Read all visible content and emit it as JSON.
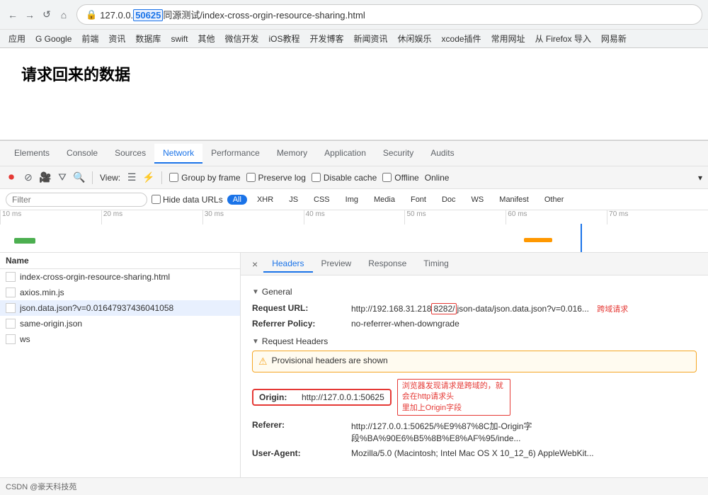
{
  "browser": {
    "nav": {
      "back_label": "←",
      "forward_label": "→",
      "reload_label": "↺",
      "url_prefix": "127.0.0.",
      "url_highlight": "50625",
      "url_suffix": "同源测试/index-cross-orgin-resource-sharing.html"
    },
    "bookmarks": [
      "应用",
      "G Google",
      "前端",
      "资讯",
      "数据库",
      "swift",
      "其他",
      "微信开发",
      "iOS教程",
      "开发博客",
      "新闻资讯",
      "休闲娱乐",
      "xcode插件",
      "常用网址",
      "从 Firefox 导入",
      "网易新"
    ]
  },
  "page": {
    "title": "请求回来的数据"
  },
  "devtools": {
    "tabs": [
      {
        "label": "Elements",
        "active": false
      },
      {
        "label": "Console",
        "active": false
      },
      {
        "label": "Sources",
        "active": false
      },
      {
        "label": "Network",
        "active": true
      },
      {
        "label": "Performance",
        "active": false
      },
      {
        "label": "Memory",
        "active": false
      },
      {
        "label": "Application",
        "active": false
      },
      {
        "label": "Security",
        "active": false
      },
      {
        "label": "Audits",
        "active": false
      }
    ],
    "toolbar": {
      "view_label": "View:",
      "group_by_frame_label": "Group by frame",
      "preserve_log_label": "Preserve log",
      "disable_cache_label": "Disable cache",
      "offline_label": "Offline",
      "online_label": "Online"
    },
    "filter": {
      "placeholder": "Filter",
      "hide_data_urls_label": "Hide data URLs",
      "types": [
        "All",
        "XHR",
        "JS",
        "CSS",
        "Img",
        "Media",
        "Font",
        "Doc",
        "WS",
        "Manifest",
        "Other"
      ]
    },
    "timeline": {
      "ticks": [
        "10 ms",
        "20 ms",
        "30 ms",
        "40 ms",
        "50 ms",
        "60 ms",
        "70 ms"
      ]
    },
    "file_list": {
      "header": "Name",
      "files": [
        {
          "name": "index-cross-orgin-resource-sharing.html",
          "selected": false
        },
        {
          "name": "axios.min.js",
          "selected": false
        },
        {
          "name": "json.data.json?v=0.01647937436041058",
          "selected": true
        },
        {
          "name": "same-origin.json",
          "selected": false
        },
        {
          "name": "ws",
          "selected": false
        }
      ]
    },
    "detail": {
      "close_label": "×",
      "tabs": [
        {
          "label": "Headers",
          "active": true
        },
        {
          "label": "Preview",
          "active": false
        },
        {
          "label": "Response",
          "active": false
        },
        {
          "label": "Timing",
          "active": false
        }
      ],
      "general": {
        "title": "General",
        "rows": [
          {
            "label": "Request URL:",
            "value": "http://192.168.31.218",
            "highlight": "8282/",
            "suffix": "json-data/json.data.json?v=0.016..."
          },
          {
            "label": "Referrer Policy:",
            "value": "no-referrer-when-downgrade"
          }
        ]
      },
      "request_headers": {
        "title": "Request Headers",
        "warning": "Provisional headers are shown",
        "rows": [
          {
            "label": "Origin:",
            "value": "http://127.0.0.1:50625",
            "boxed": true
          },
          {
            "label": "Referer:",
            "value": "http://127.0.0.1:50625/%E9%87%8C加-Origin字段%BA%90E6%B5%8B%E8%AF%95/inde..."
          },
          {
            "label": "User-Agent:",
            "value": "Mozilla/5.0 (Macintosh; Intel Mac OS X 10_12_6) AppleWebKit..."
          }
        ]
      }
    }
  },
  "annotations": {
    "request_url_note": "跨域请求",
    "origin_note": "浏览器发现请求是跨域的，就会在http请求头",
    "origin_note2": "里加上Origin字段"
  },
  "bottom": {
    "label": "CSDN @豪天科技苑"
  }
}
